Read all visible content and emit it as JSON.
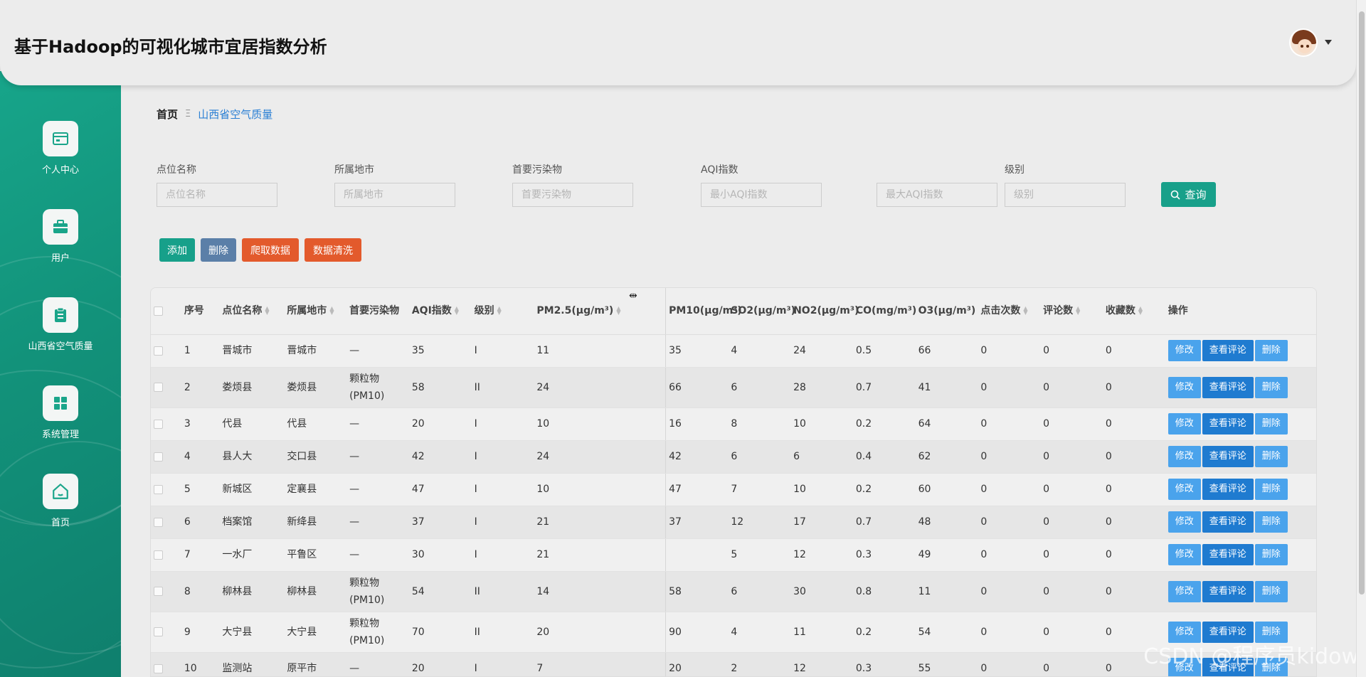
{
  "header": {
    "title": "基于Hadoop的可视化城市宜居指数分析"
  },
  "sidebar": {
    "items": [
      {
        "label": "个人中心",
        "icon": "wallet-icon"
      },
      {
        "label": "用户",
        "icon": "briefcase-icon"
      },
      {
        "label": "山西省空气质量",
        "icon": "clipboard-icon"
      },
      {
        "label": "系统管理",
        "icon": "grid-icon"
      },
      {
        "label": "首页",
        "icon": "home-icon"
      }
    ]
  },
  "breadcrumb": {
    "home": "首页",
    "separator": "Ξ",
    "current": "山西省空气质量"
  },
  "filters": [
    {
      "label": "点位名称",
      "placeholder": "点位名称"
    },
    {
      "label": "所属地市",
      "placeholder": "所属地市"
    },
    {
      "label": "首要污染物",
      "placeholder": "首要污染物"
    },
    {
      "label": "AQI指数",
      "placeholder": "最小AQI指数"
    },
    {
      "label": "",
      "placeholder": "最大AQI指数"
    },
    {
      "label": "级别",
      "placeholder": "级别"
    }
  ],
  "query_label": "查询",
  "actions": {
    "add": "添加",
    "delete": "删除",
    "crawl": "爬取数据",
    "clean": "数据清洗"
  },
  "table": {
    "headers": [
      "序号",
      "点位名称",
      "所属地市",
      "首要污染物",
      "AQI指数",
      "级别",
      "PM2.5(μg/m³)",
      "PM10(μg/m³)",
      "SO2(μg/m³)",
      "NO2(μg/m³)",
      "CO(mg/m³)",
      "O3(μg/m³)",
      "点击次数",
      "评论数",
      "收藏数",
      "操作"
    ],
    "op_labels": {
      "edit": "修改",
      "view": "查看评论",
      "delete": "删除"
    },
    "rows": [
      [
        "1",
        "晋城市",
        "晋城市",
        "—",
        "35",
        "I",
        "11",
        "35",
        "4",
        "24",
        "0.5",
        "66",
        "0",
        "0",
        "0"
      ],
      [
        "2",
        "娄烦县",
        "娄烦县",
        "颗粒物(PM10)",
        "58",
        "II",
        "24",
        "66",
        "6",
        "28",
        "0.7",
        "41",
        "0",
        "0",
        "0"
      ],
      [
        "3",
        "代县",
        "代县",
        "—",
        "20",
        "I",
        "10",
        "16",
        "8",
        "10",
        "0.2",
        "64",
        "0",
        "0",
        "0"
      ],
      [
        "4",
        "县人大",
        "交口县",
        "—",
        "42",
        "I",
        "24",
        "42",
        "6",
        "6",
        "0.4",
        "62",
        "0",
        "0",
        "0"
      ],
      [
        "5",
        "新城区",
        "定襄县",
        "—",
        "47",
        "I",
        "10",
        "47",
        "7",
        "10",
        "0.2",
        "60",
        "0",
        "0",
        "0"
      ],
      [
        "6",
        "档案馆",
        "新绛县",
        "—",
        "37",
        "I",
        "21",
        "37",
        "12",
        "17",
        "0.7",
        "48",
        "0",
        "0",
        "0"
      ],
      [
        "7",
        "一水厂",
        "平鲁区",
        "—",
        "30",
        "I",
        "21",
        "",
        "5",
        "12",
        "0.3",
        "49",
        "0",
        "0",
        "0"
      ],
      [
        "8",
        "柳林县",
        "柳林县",
        "颗粒物(PM10)",
        "54",
        "II",
        "14",
        "58",
        "6",
        "30",
        "0.8",
        "11",
        "0",
        "0",
        "0"
      ],
      [
        "9",
        "大宁县",
        "大宁县",
        "颗粒物(PM10)",
        "70",
        "II",
        "20",
        "90",
        "4",
        "11",
        "0.2",
        "54",
        "0",
        "0",
        "0"
      ],
      [
        "10",
        "监测站",
        "原平市",
        "—",
        "20",
        "I",
        "7",
        "20",
        "2",
        "12",
        "0.3",
        "55",
        "0",
        "0",
        "0"
      ]
    ]
  },
  "watermark": "CSDN @程序员kidow"
}
